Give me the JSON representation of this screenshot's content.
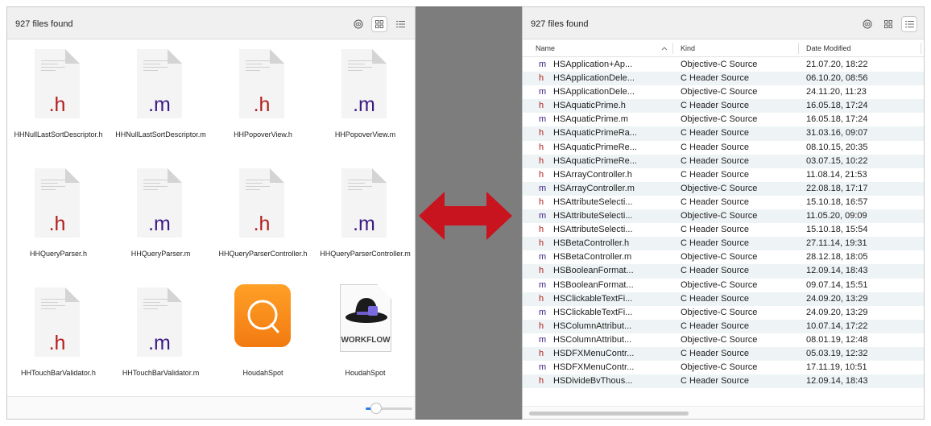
{
  "left": {
    "file_count": "927 files found",
    "items": [
      {
        "ext": ".h",
        "label": "HHNullLastSortDescriptor.h"
      },
      {
        "ext": ".m",
        "label": "HHNullLastSortDescriptor.m"
      },
      {
        "ext": ".h",
        "label": "HHPopoverView.h"
      },
      {
        "ext": ".m",
        "label": "HHPopoverView.m"
      },
      {
        "ext": ".h",
        "label": "HHQueryParser.h"
      },
      {
        "ext": ".m",
        "label": "HHQueryParser.m"
      },
      {
        "ext": ".h",
        "label": "HHQueryParserController.h"
      },
      {
        "ext": ".m",
        "label": "HHQueryParserController.m"
      },
      {
        "ext": ".h",
        "label": "HHTouchBarValidator.h"
      },
      {
        "ext": ".m",
        "label": "HHTouchBarValidator.m"
      },
      {
        "ext": "",
        "label": "HoudahSpot"
      },
      {
        "ext": "",
        "label": "HoudahSpot",
        "badge": "WORKFLOW"
      }
    ],
    "zoom_level": 0.22
  },
  "right": {
    "file_count": "927 files found",
    "columns": {
      "name": "Name",
      "kind": "Kind",
      "date": "Date Modified"
    },
    "rows": [
      {
        "type": "m",
        "name": "HSApplication+Ap...",
        "kind": "Objective-C Source",
        "date": "21.07.20, 18:22"
      },
      {
        "type": "h",
        "name": "HSApplicationDele...",
        "kind": "C Header Source",
        "date": "06.10.20, 08:56"
      },
      {
        "type": "m",
        "name": "HSApplicationDele...",
        "kind": "Objective-C Source",
        "date": "24.11.20, 11:23"
      },
      {
        "type": "h",
        "name": "HSAquaticPrime.h",
        "kind": "C Header Source",
        "date": "16.05.18, 17:24"
      },
      {
        "type": "m",
        "name": "HSAquaticPrime.m",
        "kind": "Objective-C Source",
        "date": "16.05.18, 17:24"
      },
      {
        "type": "h",
        "name": "HSAquaticPrimeRa...",
        "kind": "C Header Source",
        "date": "31.03.16, 09:07"
      },
      {
        "type": "h",
        "name": "HSAquaticPrimeRe...",
        "kind": "C Header Source",
        "date": "08.10.15, 20:35"
      },
      {
        "type": "h",
        "name": "HSAquaticPrimeRe...",
        "kind": "C Header Source",
        "date": "03.07.15, 10:22"
      },
      {
        "type": "h",
        "name": "HSArrayController.h",
        "kind": "C Header Source",
        "date": "11.08.14, 21:53"
      },
      {
        "type": "m",
        "name": "HSArrayController.m",
        "kind": "Objective-C Source",
        "date": "22.08.18, 17:17"
      },
      {
        "type": "h",
        "name": "HSAttributeSelecti...",
        "kind": "C Header Source",
        "date": "15.10.18, 16:57"
      },
      {
        "type": "m",
        "name": "HSAttributeSelecti...",
        "kind": "Objective-C Source",
        "date": "11.05.20, 09:09"
      },
      {
        "type": "h",
        "name": "HSAttributeSelecti...",
        "kind": "C Header Source",
        "date": "15.10.18, 15:54"
      },
      {
        "type": "h",
        "name": "HSBetaController.h",
        "kind": "C Header Source",
        "date": "27.11.14, 19:31"
      },
      {
        "type": "m",
        "name": "HSBetaController.m",
        "kind": "Objective-C Source",
        "date": "28.12.18, 18:05"
      },
      {
        "type": "h",
        "name": "HSBooleanFormat...",
        "kind": "C Header Source",
        "date": "12.09.14, 18:43"
      },
      {
        "type": "m",
        "name": "HSBooleanFormat...",
        "kind": "Objective-C Source",
        "date": "09.07.14, 15:51"
      },
      {
        "type": "h",
        "name": "HSClickableTextFi...",
        "kind": "C Header Source",
        "date": "24.09.20, 13:29"
      },
      {
        "type": "m",
        "name": "HSClickableTextFi...",
        "kind": "Objective-C Source",
        "date": "24.09.20, 13:29"
      },
      {
        "type": "h",
        "name": "HSColumnAttribut...",
        "kind": "C Header Source",
        "date": "10.07.14, 17:22"
      },
      {
        "type": "m",
        "name": "HSColumnAttribut...",
        "kind": "Objective-C Source",
        "date": "08.01.19, 12:48"
      },
      {
        "type": "h",
        "name": "HSDFXMenuContr...",
        "kind": "C Header Source",
        "date": "05.03.19, 12:32"
      },
      {
        "type": "m",
        "name": "HSDFXMenuContr...",
        "kind": "Objective-C Source",
        "date": "17.11.19, 10:51"
      },
      {
        "type": "h",
        "name": "HSDivideBvThous...",
        "kind": "C Header Source",
        "date": "12.09.14, 18:43"
      }
    ]
  },
  "colors": {
    "header_ext": "#b21e1e",
    "source_ext": "#3d1a86",
    "arrow": "#c8141e",
    "divider": "#7d7d7d",
    "accent": "#2f7df6"
  }
}
